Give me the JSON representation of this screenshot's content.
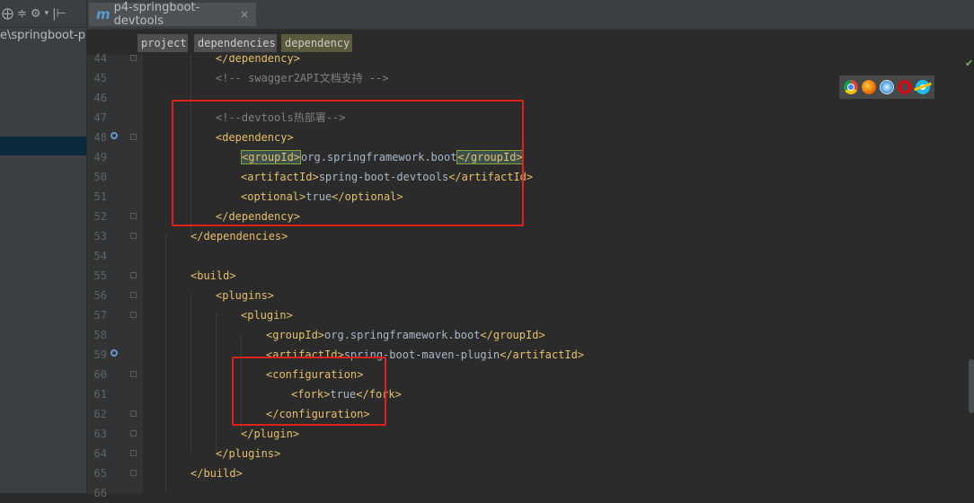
{
  "window": {
    "left_path": "e\\springboot-pr",
    "left_toolbar": [
      "⨁",
      "≑",
      "⚙",
      "▾",
      "|⊢"
    ]
  },
  "tab": {
    "icon_letter": "m",
    "title": "p4-springboot-devtools",
    "close": "×"
  },
  "breadcrumbs": [
    "project",
    "dependencies",
    "dependency"
  ],
  "browser_icons": [
    "chrome-icon",
    "firefox-icon",
    "safari-icon",
    "opera-icon",
    "ie-icon"
  ],
  "colors": {
    "tag": "#e8bf6a",
    "text": "#a9b7c6",
    "comment": "#808080",
    "highlight_box": "#e0231a",
    "selected_row": "#0d293e"
  },
  "editor": {
    "lines": [
      {
        "num": "44",
        "segments": [
          {
            "c": "t",
            "v": "</dependency>"
          }
        ]
      },
      {
        "num": "45",
        "segments": [
          {
            "c": "cm",
            "v": "<!-- swagger2API文档支持 -->"
          }
        ]
      },
      {
        "num": "46",
        "segments": []
      },
      {
        "num": "47",
        "segments": [
          {
            "c": "cm",
            "v": "<!--devtools热部署-->"
          }
        ]
      },
      {
        "num": "48",
        "segments": [
          {
            "c": "t",
            "v": "<dependency>"
          }
        ]
      },
      {
        "num": "49",
        "segments": [
          {
            "c": "t hl",
            "v": "<groupId>"
          },
          {
            "c": "txt",
            "v": "org.springframework.boot"
          },
          {
            "c": "t hl",
            "v": "</groupId>"
          }
        ]
      },
      {
        "num": "50",
        "segments": [
          {
            "c": "t",
            "v": "<artifactId>"
          },
          {
            "c": "txt",
            "v": "spring-boot-devtools"
          },
          {
            "c": "t",
            "v": "</artifactId>"
          }
        ]
      },
      {
        "num": "51",
        "segments": [
          {
            "c": "t",
            "v": "<optional>"
          },
          {
            "c": "txt",
            "v": "true"
          },
          {
            "c": "t",
            "v": "</optional>"
          }
        ]
      },
      {
        "num": "52",
        "segments": [
          {
            "c": "t",
            "v": "</dependency>"
          }
        ]
      },
      {
        "num": "53",
        "segments": [
          {
            "c": "t",
            "v": "</dependencies>"
          }
        ]
      },
      {
        "num": "54",
        "segments": []
      },
      {
        "num": "55",
        "segments": [
          {
            "c": "t",
            "v": "<build>"
          }
        ]
      },
      {
        "num": "56",
        "segments": [
          {
            "c": "t",
            "v": "<plugins>"
          }
        ]
      },
      {
        "num": "57",
        "segments": [
          {
            "c": "t",
            "v": "<plugin>"
          }
        ]
      },
      {
        "num": "58",
        "segments": [
          {
            "c": "t",
            "v": "<groupId>"
          },
          {
            "c": "txt",
            "v": "org.springframework.boot"
          },
          {
            "c": "t",
            "v": "</groupId>"
          }
        ]
      },
      {
        "num": "59",
        "segments": [
          {
            "c": "t",
            "v": "<artifactId>"
          },
          {
            "c": "txt",
            "v": "spring-boot-maven-plugin"
          },
          {
            "c": "t",
            "v": "</artifactId>"
          }
        ]
      },
      {
        "num": "60",
        "segments": [
          {
            "c": "t",
            "v": "<configuration>"
          }
        ]
      },
      {
        "num": "61",
        "segments": [
          {
            "c": "t",
            "v": "<fork>"
          },
          {
            "c": "txt",
            "v": "true"
          },
          {
            "c": "t",
            "v": "</fork>"
          }
        ]
      },
      {
        "num": "62",
        "segments": [
          {
            "c": "t",
            "v": "</configuration>"
          }
        ]
      },
      {
        "num": "63",
        "segments": [
          {
            "c": "t",
            "v": "</plugin>"
          }
        ]
      },
      {
        "num": "64",
        "segments": [
          {
            "c": "t",
            "v": "</plugins>"
          }
        ]
      },
      {
        "num": "65",
        "segments": [
          {
            "c": "t",
            "v": "</build>"
          }
        ]
      },
      {
        "num": "66",
        "segments": []
      }
    ]
  }
}
